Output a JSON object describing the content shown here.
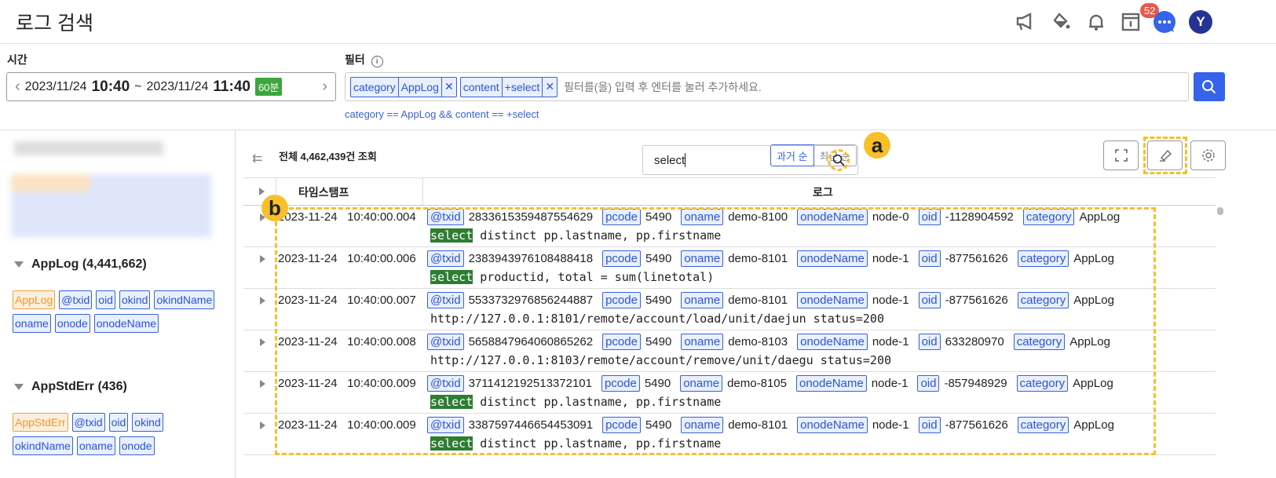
{
  "header": {
    "title": "로그 검색",
    "notification_count": "52",
    "avatar_letter": "Y"
  },
  "time": {
    "label": "시간",
    "start_date": "2023/11/24",
    "start_time": "10:40",
    "sep": "~",
    "end_date": "2023/11/24",
    "end_time": "11:40",
    "duration": "60분"
  },
  "filter": {
    "label": "필터",
    "chips": [
      [
        "category",
        "AppLog"
      ],
      [
        "content",
        "+select"
      ]
    ],
    "remove": "✕",
    "placeholder": "필터를(을) 입력 후 엔터를 눌러 추가하세요.",
    "query": "category == AppLog && content == +select"
  },
  "sidebar": {
    "groups": [
      {
        "title": "AppLog (4,441,662)",
        "tags": [
          "AppLog",
          "@txid",
          "oid",
          "okind",
          "okindName",
          "oname",
          "onode",
          "onodeName"
        ]
      },
      {
        "title": "AppStdErr (436)",
        "tags": [
          "AppStdErr",
          "@txid",
          "oid",
          "okind",
          "okindName",
          "oname",
          "onode"
        ]
      }
    ]
  },
  "main": {
    "count": "전체 4,462,439건 조회",
    "sort_past": "과거 순",
    "sort_recent": "최근 순",
    "search_value": "select",
    "marker_a": "a",
    "marker_b": "b",
    "col_timestamp": "타임스탬프",
    "col_log": "로그"
  },
  "colors": {
    "accent": "#3563e9",
    "highlight": "#2e7d32",
    "marker": "#f7bf2a"
  },
  "rows": [
    {
      "date": "2023-11-24",
      "time": "10:40:00.004",
      "fields": [
        [
          "@txid",
          "2833615359487554629"
        ],
        [
          "pcode",
          "5490"
        ],
        [
          "oname",
          "demo-8100"
        ],
        [
          "onodeName",
          "node-0"
        ],
        [
          "oid",
          "-1128904592"
        ],
        [
          "category",
          "AppLog"
        ]
      ],
      "hl": "select",
      "rest": " distinct pp.lastname, pp.firstname"
    },
    {
      "date": "2023-11-24",
      "time": "10:40:00.006",
      "fields": [
        [
          "@txid",
          "2383943976108488418"
        ],
        [
          "pcode",
          "5490"
        ],
        [
          "oname",
          "demo-8101"
        ],
        [
          "onodeName",
          "node-1"
        ],
        [
          "oid",
          "-877561626"
        ],
        [
          "category",
          "AppLog"
        ]
      ],
      "hl": "select",
      "rest": " productid, total = sum(linetotal)"
    },
    {
      "date": "2023-11-24",
      "time": "10:40:00.007",
      "fields": [
        [
          "@txid",
          "5533732976856244887"
        ],
        [
          "pcode",
          "5490"
        ],
        [
          "oname",
          "demo-8101"
        ],
        [
          "onodeName",
          "node-1"
        ],
        [
          "oid",
          "-877561626"
        ],
        [
          "category",
          "AppLog"
        ]
      ],
      "hl": "",
      "rest": "http://127.0.0.1:8101/remote/account/load/unit/daejun status=200"
    },
    {
      "date": "2023-11-24",
      "time": "10:40:00.008",
      "fields": [
        [
          "@txid",
          "5658847964060865262"
        ],
        [
          "pcode",
          "5490"
        ],
        [
          "oname",
          "demo-8103"
        ],
        [
          "onodeName",
          "node-1"
        ],
        [
          "oid",
          "633280970"
        ],
        [
          "category",
          "AppLog"
        ]
      ],
      "hl": "",
      "rest": "http://127.0.0.1:8103/remote/account/remove/unit/daegu status=200"
    },
    {
      "date": "2023-11-24",
      "time": "10:40:00.009",
      "fields": [
        [
          "@txid",
          "3711412192513372101"
        ],
        [
          "pcode",
          "5490"
        ],
        [
          "oname",
          "demo-8105"
        ],
        [
          "onodeName",
          "node-1"
        ],
        [
          "oid",
          "-857948929"
        ],
        [
          "category",
          "AppLog"
        ]
      ],
      "hl": "select",
      "rest": " distinct pp.lastname, pp.firstname"
    },
    {
      "date": "2023-11-24",
      "time": "10:40:00.009",
      "fields": [
        [
          "@txid",
          "3387597446654453091"
        ],
        [
          "pcode",
          "5490"
        ],
        [
          "oname",
          "demo-8101"
        ],
        [
          "onodeName",
          "node-1"
        ],
        [
          "oid",
          "-877561626"
        ],
        [
          "category",
          "AppLog"
        ]
      ],
      "hl": "select",
      "rest": " distinct pp.lastname, pp.firstname"
    }
  ]
}
